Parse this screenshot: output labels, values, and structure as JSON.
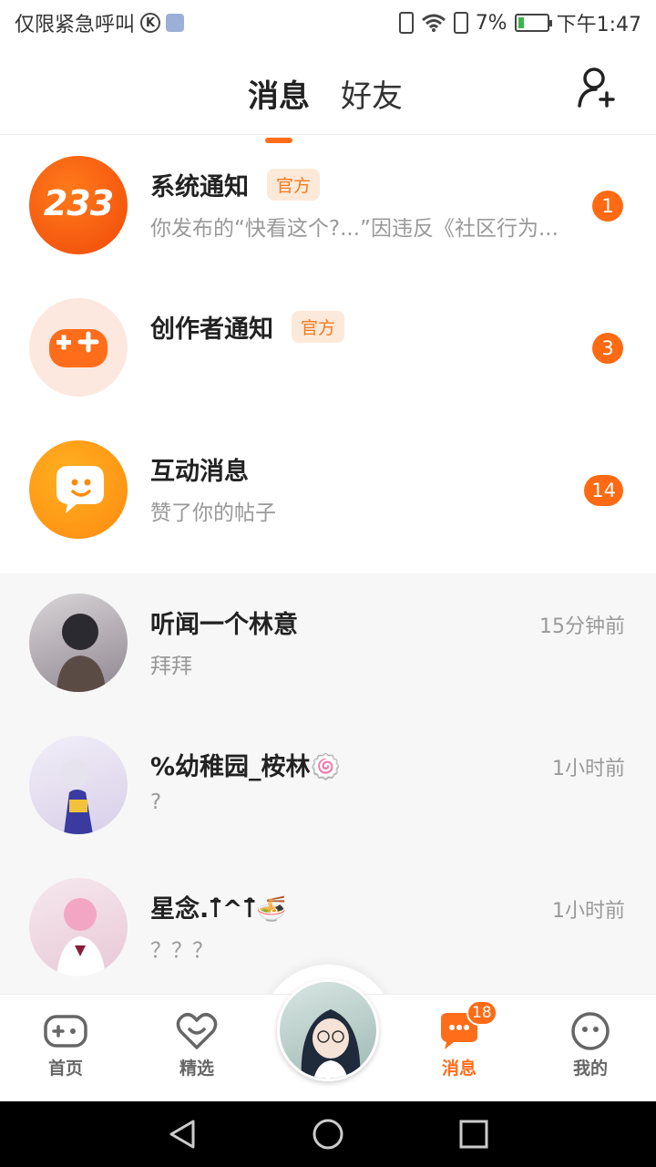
{
  "status_bar": {
    "carrier_text": "仅限紧急呼叫",
    "k_icon_letter": "K",
    "battery_percent": "7%",
    "time": "下午1:47"
  },
  "header": {
    "tabs": [
      {
        "label": "消息",
        "active": true
      },
      {
        "label": "好友",
        "active": false
      }
    ],
    "add_friend_icon": "add-person-icon"
  },
  "messages": [
    {
      "title": "系统通知",
      "tag": "官方",
      "subtitle": "你发布的“快看这个?...”因违反《社区行为...",
      "badge": "1",
      "avatar_text": "233"
    },
    {
      "title": "创作者通知",
      "tag": "官方",
      "subtitle": "",
      "badge": "3"
    },
    {
      "title": "互动消息",
      "subtitle": "赞了你的帖子",
      "badge": "14"
    },
    {
      "title": "听闻一个林意",
      "subtitle": "拜拜",
      "time": "15分钟前"
    },
    {
      "title": "%幼稚园_桉林🍥",
      "subtitle": "?",
      "time": "1小时前"
    },
    {
      "title": "星念.⊺̂^⊺̂🍜",
      "subtitle": "？？？",
      "time": "1小时前"
    }
  ],
  "bottom_nav": [
    {
      "label": "首页",
      "icon": "gamepad-icon"
    },
    {
      "label": "精选",
      "icon": "heart-icon"
    },
    {
      "label": "消息",
      "icon": "message-icon",
      "badge": "18",
      "active": true
    },
    {
      "label": "我的",
      "icon": "smile-icon"
    }
  ],
  "colors": {
    "accent": "#ff6d1a",
    "badge": "#ff6a13",
    "tag_bg": "#fde9d9"
  }
}
